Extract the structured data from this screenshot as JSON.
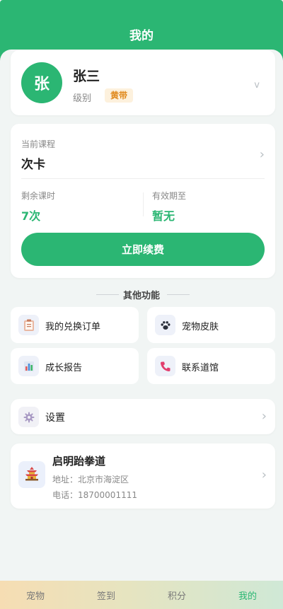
{
  "header": {
    "title": "我的"
  },
  "profile": {
    "avatar_char": "张",
    "name": "张三",
    "level_label": "级别",
    "level_badge": "黄带",
    "chevron": "v"
  },
  "course": {
    "label": "当前课程",
    "name": "次卡",
    "chevron": "›",
    "remaining_label": "剩余课时",
    "remaining_value": "7次",
    "expiry_label": "有效期至",
    "expiry_value": "暂无",
    "renew_button": "立即续费"
  },
  "other_features": {
    "title": "其他功能",
    "items": [
      {
        "label": "我的兑换订单",
        "icon": "clipboard-icon"
      },
      {
        "label": "宠物皮肤",
        "icon": "paw-icon"
      },
      {
        "label": "成长报告",
        "icon": "bar-chart-icon"
      },
      {
        "label": "联系道馆",
        "icon": "phone-icon"
      }
    ]
  },
  "settings": {
    "label": "设置",
    "icon": "gear-icon",
    "chevron": "›"
  },
  "gym": {
    "name": "启明跆拳道",
    "address": "地址：北京市海淀区",
    "phone": "电话：18700001111",
    "icon": "pagoda-icon",
    "chevron": "›"
  },
  "tabbar": {
    "items": [
      {
        "label": "宠物"
      },
      {
        "label": "签到"
      },
      {
        "label": "积分"
      },
      {
        "label": "我的"
      }
    ],
    "active_index": 3
  },
  "colors": {
    "primary": "#2bb673",
    "badge_bg": "#fdf1dd",
    "badge_text": "#e08a1e"
  }
}
